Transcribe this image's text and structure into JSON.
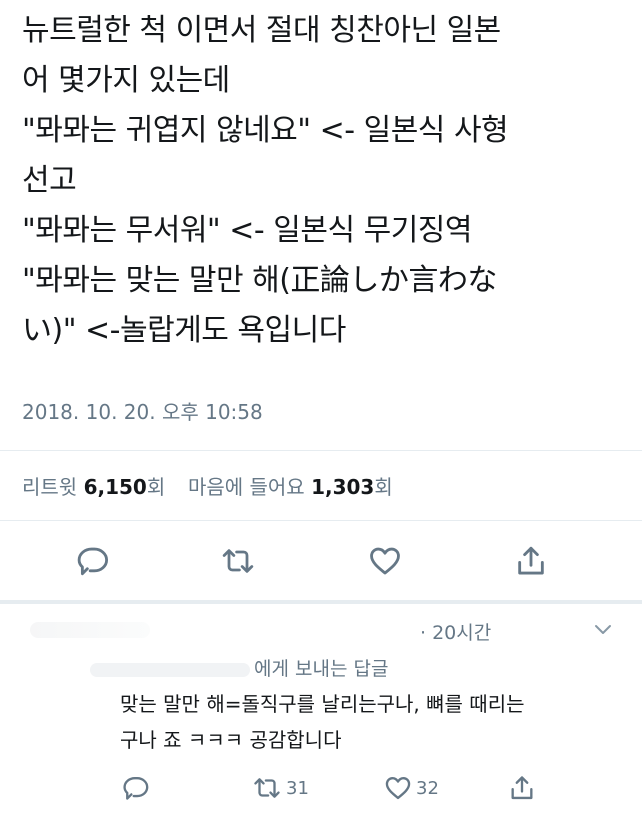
{
  "tweet": {
    "lines": [
      "뉴트럴한 척 이면서 절대 칭찬아닌 일본",
      "어 몇가지 있는데",
      "\"뫄뫄는 귀엽지 않네요\" <- 일본식 사형",
      "선고",
      "\"뫄뫄는 무서워\" <- 일본식 무기징역",
      "\"뫄뫄는 맞는 말만 해(正論しか言わな",
      "い)\" <-놀랍게도 욕입니다"
    ],
    "timestamp": "2018. 10. 20. 오후 10:58"
  },
  "stats": {
    "retweets_label": "리트윗",
    "retweets_count": "6,150",
    "retweets_unit": "회",
    "likes_label": "마음에 들어요",
    "likes_count": "1,303",
    "likes_unit": "회"
  },
  "actions": {
    "reply_icon": "reply-icon",
    "retweet_icon": "retweet-icon",
    "like_icon": "heart-icon",
    "share_icon": "share-icon"
  },
  "reply": {
    "time": "· 20시간",
    "replying_to": "에게 보내는 답글",
    "lines": [
      "맞는 말만 해=돌직구를 날리는구나, 뼈를 때리는",
      "구나 죠 ㅋㅋㅋ 공감합니다"
    ],
    "retweet_count": "31",
    "like_count": "32"
  },
  "colors": {
    "text": "#14171a",
    "secondary": "#657786",
    "divider": "#e6ecf0"
  }
}
